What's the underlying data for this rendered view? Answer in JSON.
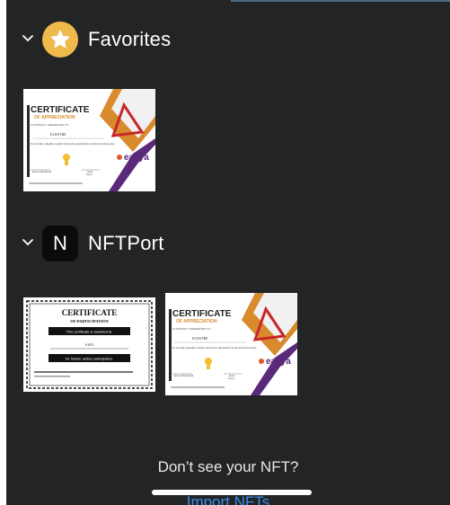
{
  "sections": {
    "favorites": {
      "title": "Favorites",
      "icon": "star-icon"
    },
    "nftport": {
      "title": "NFTPort",
      "icon_letter": "N"
    }
  },
  "certificates": {
    "appreciation": {
      "title": "CERTIFICATE",
      "subtitle": "OF APPRECIATION",
      "presented": "IS PROUDLY PRESENTED TO :",
      "recipient": "ELDSTRE",
      "body": "To provide valuable insight during the Hackathon at Harvard University",
      "sign_left": "Event Weekend",
      "sign_right": "Host",
      "sign_right_sub": "Easya",
      "brand": "easya"
    },
    "participation": {
      "title": "CERTIFICATE",
      "subtitle": "OF PARTICIPATION",
      "awarded": "This certificate is awarded to:",
      "recipient": "V.BTI",
      "reason": "for his/her active participation."
    }
  },
  "footer": {
    "prompt": "Don’t see your NFT?",
    "import_label": "Import NFTs"
  },
  "colors": {
    "background": "#232426",
    "accent": "#3b8fe6",
    "star": "#f0b94b",
    "orange": "#d88a2c",
    "purple": "#5a2a7a",
    "red": "#c8262a"
  }
}
